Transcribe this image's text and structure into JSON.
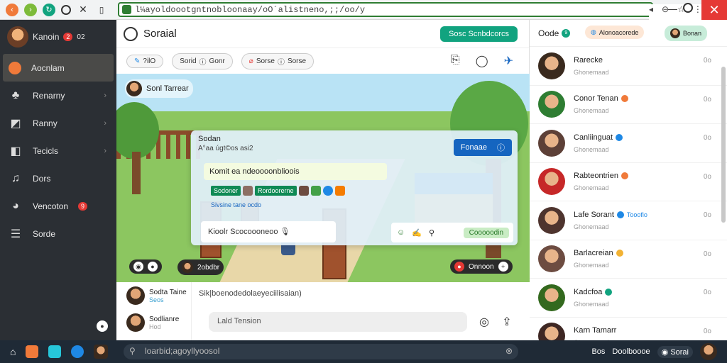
{
  "browser": {
    "address": "l¼ayoldoootgntnobloonaay/oO´alistneno,;;/oo/y",
    "close_label": "✕"
  },
  "sidebar": {
    "user_name": "Kanoin",
    "user_badge": "2",
    "user_extra": "02",
    "items": [
      {
        "label": "Aocnlam",
        "icon": "orange-circle-icon",
        "active": true
      },
      {
        "label": "Renarny",
        "icon": "users-icon"
      },
      {
        "label": "Ranny",
        "icon": "pin-icon"
      },
      {
        "label": "Tecicls",
        "icon": "tag-icon"
      },
      {
        "label": "Dors",
        "icon": "music-icon"
      },
      {
        "label": "Vencoton",
        "icon": "clock-icon",
        "badge": "9"
      },
      {
        "label": "Sorde",
        "icon": "menu-icon"
      }
    ]
  },
  "main": {
    "title": "Soraial",
    "green_button": "Sosc Scnbdcorcs",
    "pills": [
      "?ilO",
      "Sorid",
      "Gonr",
      "Sorse",
      "Gonr",
      "Sorse"
    ],
    "scene_header": "Sonl Tarrear",
    "scene_pills": {
      "left": "2obdbr",
      "right": "Onnoon"
    },
    "overlay": {
      "title": "Sodan",
      "subtitle": "A°aa úgt©os asi2",
      "blue_button": "Fonaae",
      "message": "Komit ea ndeoooonblioois",
      "tag1": "Sodoner",
      "tag2": "Rordoorerne",
      "link": "Sivsine tane ocdo",
      "input_placeholder": "Kioolr Scocoooneoo",
      "send": "Cooooodin"
    },
    "lower_contacts": [
      {
        "name": "Sodta Taine",
        "sub": "Seos"
      },
      {
        "name": "Sodlianre",
        "sub": "Hod"
      }
    ],
    "lower_placeholder": "Sik|boenodedolaeyeciilisaian)",
    "chat_input": "Lald Tension"
  },
  "right": {
    "title": "Oode",
    "count": "9",
    "pill1": "Alonoacorede",
    "pill2": "Bonan",
    "contacts": [
      {
        "name": "Rarecke",
        "status": "Ghonemaad",
        "status_color": ""
      },
      {
        "name": "Conor Tenan",
        "status": "Ghonemaad",
        "status_color": "#f07a3a"
      },
      {
        "name": "Canliinguat",
        "status": "Ghonemaad",
        "status_color": "#1e88e5"
      },
      {
        "name": "Rabteontrien",
        "status": "Ghonemaad",
        "status_color": "#f07a3a"
      },
      {
        "name": "Lafe Sorant",
        "status": "Ghonemaad",
        "status_color": "#1e88e5",
        "extra": "Tooofio"
      },
      {
        "name": "Barlacreian",
        "status": "Ghonemaad",
        "status_color": "#f2b233"
      },
      {
        "name": "Kadcfoa",
        "status": "Ghonemaad",
        "status_color": "#11a37f"
      },
      {
        "name": "Karn Tamarr",
        "status": "Ghonemaad",
        "status_color": ""
      }
    ],
    "more": "0o"
  },
  "taskbar": {
    "search": "loarbid;agoyllyoosol",
    "tray_items": [
      "Bos",
      "Doolboooe",
      "Sorai"
    ]
  }
}
